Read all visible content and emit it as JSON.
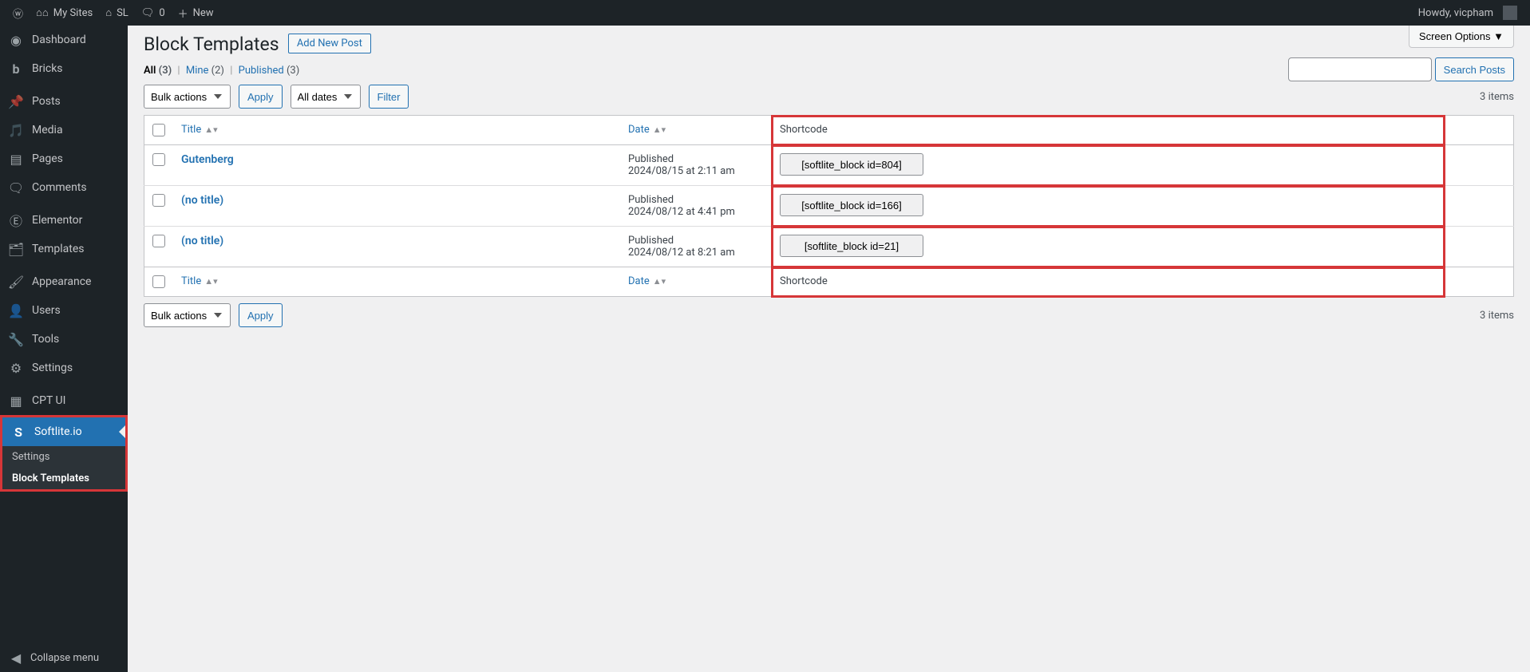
{
  "topbar": {
    "my_sites": "My Sites",
    "site_name": "SL",
    "comments": "0",
    "new": "New",
    "howdy": "Howdy, vicpham"
  },
  "sidebar": {
    "items": [
      {
        "icon": "dashboard",
        "label": "Dashboard"
      },
      {
        "icon": "bricks",
        "label": "Bricks"
      },
      {
        "icon": "posts",
        "label": "Posts"
      },
      {
        "icon": "media",
        "label": "Media"
      },
      {
        "icon": "pages",
        "label": "Pages"
      },
      {
        "icon": "comments",
        "label": "Comments"
      },
      {
        "icon": "elementor",
        "label": "Elementor"
      },
      {
        "icon": "templates",
        "label": "Templates"
      },
      {
        "icon": "appearance",
        "label": "Appearance"
      },
      {
        "icon": "users",
        "label": "Users"
      },
      {
        "icon": "tools",
        "label": "Tools"
      },
      {
        "icon": "settings",
        "label": "Settings"
      },
      {
        "icon": "cptui",
        "label": "CPT UI"
      },
      {
        "icon": "softlite",
        "label": "Softlite.io"
      }
    ],
    "submenu": {
      "settings": "Settings",
      "block_templates": "Block Templates"
    },
    "collapse": "Collapse menu"
  },
  "page": {
    "title": "Block Templates",
    "add_new": "Add New Post",
    "screen_options": "Screen Options  ▼"
  },
  "filters": {
    "all_label": "All",
    "all_count": "(3)",
    "mine_label": "Mine",
    "mine_count": "(2)",
    "published_label": "Published",
    "published_count": "(3)"
  },
  "search": {
    "button": "Search Posts"
  },
  "bulk": {
    "actions_label": "Bulk actions",
    "apply": "Apply",
    "all_dates": "All dates",
    "filter": "Filter"
  },
  "count_text": "3 items",
  "columns": {
    "title": "Title",
    "date": "Date",
    "shortcode": "Shortcode"
  },
  "rows": [
    {
      "title": "Gutenberg",
      "status": "Published",
      "date": "2024/08/15 at 2:11 am",
      "shortcode": "[softlite_block id=804]"
    },
    {
      "title": "(no title)",
      "status": "Published",
      "date": "2024/08/12 at 4:41 pm",
      "shortcode": "[softlite_block id=166]"
    },
    {
      "title": "(no title)",
      "status": "Published",
      "date": "2024/08/12 at 8:21 am",
      "shortcode": "[softlite_block id=21]"
    }
  ]
}
